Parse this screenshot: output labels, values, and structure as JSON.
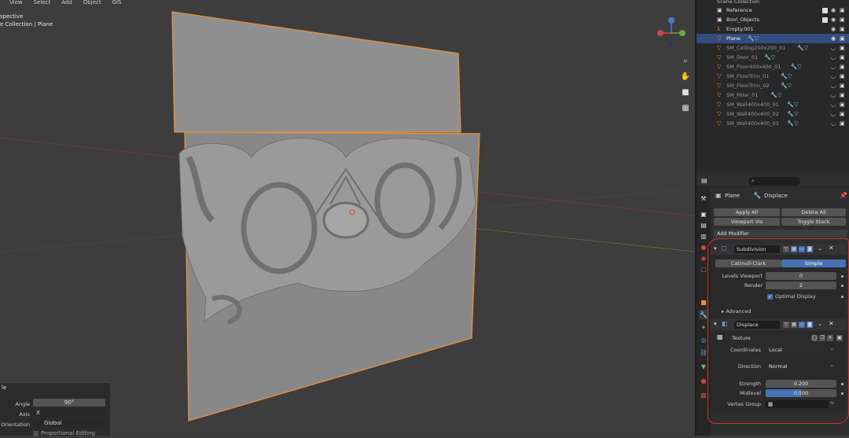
{
  "viewport": {
    "menu": [
      "View",
      "Select",
      "Add",
      "Object",
      "GIS"
    ],
    "title_line1": "spective",
    "title_line2": "e Collection | Plane"
  },
  "redo_panel": {
    "header": "le",
    "angle_label": "Angle",
    "angle_value": "90°",
    "axis_label": "Axis",
    "axis_value": "X",
    "orientation_label": "Orientation",
    "orientation_value": "Global",
    "proportional_label": "Proportional Editing"
  },
  "outliner": {
    "root": "Scene Collection",
    "items": [
      {
        "name": "Reference",
        "level": 1,
        "type": "collection"
      },
      {
        "name": "Bool_Objects",
        "level": 1,
        "type": "collection"
      },
      {
        "name": "Empty.001",
        "level": 1,
        "type": "empty"
      },
      {
        "name": "Plane",
        "level": 1,
        "type": "mesh",
        "selected": true
      },
      {
        "name": "SM_Ceiling200x200_01",
        "level": 1,
        "type": "mesh"
      },
      {
        "name": "SM_Door_01",
        "level": 1,
        "type": "mesh"
      },
      {
        "name": "SM_Floor400x400_01",
        "level": 1,
        "type": "mesh"
      },
      {
        "name": "SM_FloorTrim_01",
        "level": 1,
        "type": "mesh"
      },
      {
        "name": "SM_FloorTrim_02",
        "level": 1,
        "type": "mesh"
      },
      {
        "name": "SM_Pillar_01",
        "level": 1,
        "type": "mesh"
      },
      {
        "name": "SM_Wall400x400_01",
        "level": 1,
        "type": "mesh"
      },
      {
        "name": "SM_Wall400x400_02",
        "level": 1,
        "type": "mesh"
      },
      {
        "name": "SM_Wall400x400_03",
        "level": 1,
        "type": "mesh"
      }
    ]
  },
  "properties": {
    "search_placeholder": "",
    "breadcrumb_object": "Plane",
    "breadcrumb_modifier": "Displace",
    "apply_all": "Apply All",
    "delete_all": "Delete All",
    "viewport_vis": "Viewport Vis",
    "toggle_stack": "Toggle Stack",
    "add_modifier": "Add Modifier",
    "subdivision": {
      "name": "Subdivision",
      "mode_catmull": "Catmull-Clark",
      "mode_simple": "Simple",
      "levels_viewport_label": "Levels Viewport",
      "levels_viewport_value": "0",
      "render_label": "Render",
      "render_value": "2",
      "optimal_display": "Optimal Display",
      "advanced": "Advanced"
    },
    "displace": {
      "name": "Displace",
      "texture_value": "Texture",
      "coordinates_label": "Coordinates",
      "coordinates_value": "Local",
      "direction_label": "Direction",
      "direction_value": "Normal",
      "strength_label": "Strength",
      "strength_value": "0.200",
      "midlevel_label": "Midlevel",
      "midlevel_value": "0.500",
      "midlevel_fraction": 0.5,
      "vertex_group_label": "Vertex Group"
    }
  },
  "colors": {
    "accent": "#4772b3",
    "selection_outline": "#e8903a",
    "annotation": "#d32f2f"
  }
}
